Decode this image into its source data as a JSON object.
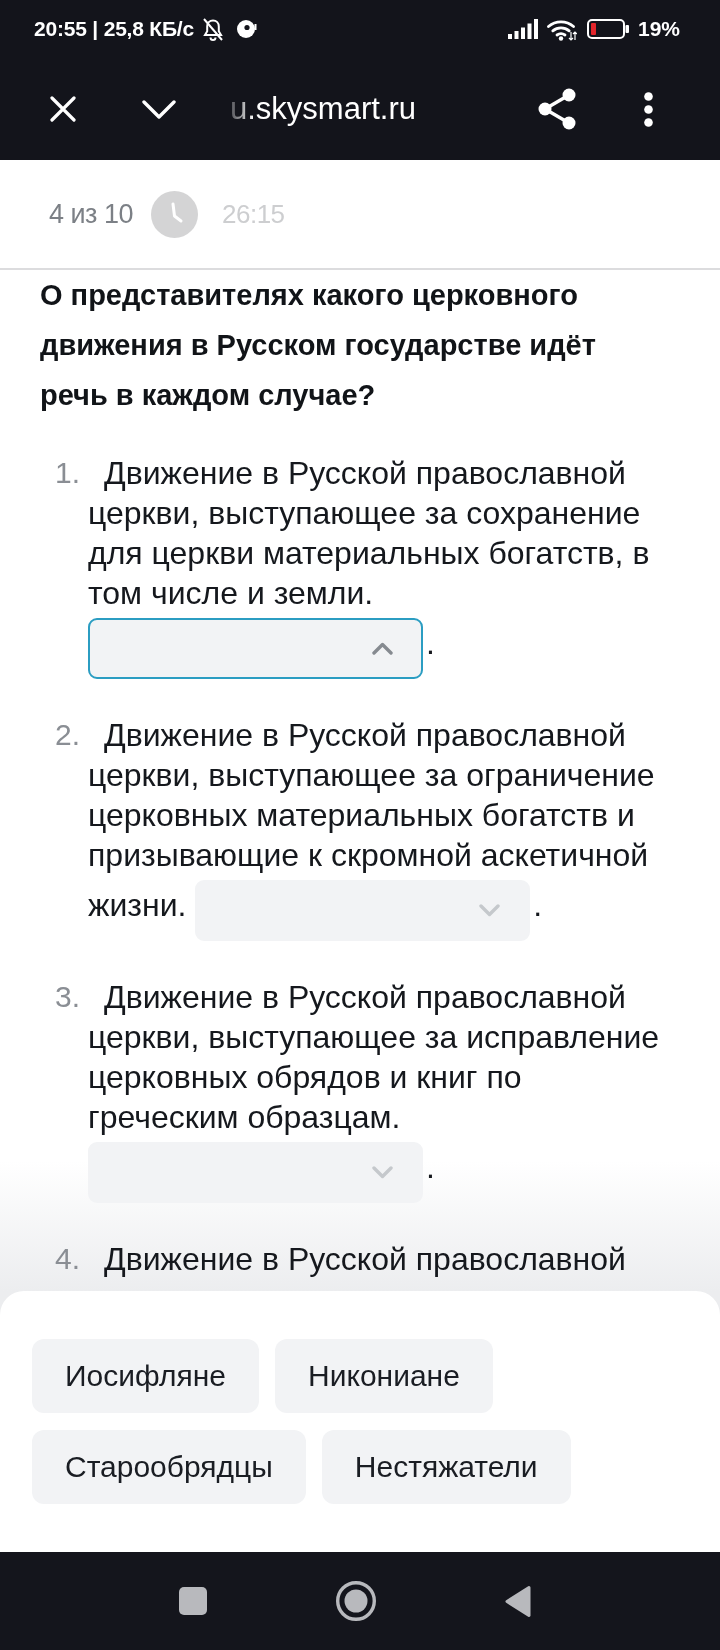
{
  "status_bar": {
    "time": "20:55 | 25,8 КБ/с",
    "battery": "19%"
  },
  "browser_bar": {
    "url": "u.skysmart.ru"
  },
  "quiz_header": {
    "counter": "4 из 10",
    "timer": "26:15"
  },
  "question": "О представителях какого церковного движения в Русском государстве идёт речь в каждом случае?",
  "items": [
    {
      "number": "1.",
      "text": "Движение в Русской православной церкви, выступающее за сохранение для церкви материальных богатств, в том числе и земли.",
      "dropdown": {
        "expanded": true
      },
      "suffix": "."
    },
    {
      "number": "2.",
      "text": "Движение в Русской православной церкви, выступающее за ограничение церковных материальных богатств и призывающие к скромной аскетичной жизни.",
      "dropdown": {
        "expanded": false
      },
      "suffix": "."
    },
    {
      "number": "3.",
      "text": "Движение в Русской православной церкви, выступающее за исправление церковных обрядов и книг по греческим образцам.",
      "dropdown": {
        "expanded": false
      },
      "suffix": "."
    },
    {
      "number": "4.",
      "text": "Движение в Русской православной"
    }
  ],
  "answer_options": [
    "Иосифляне",
    "Никониане",
    "Старообрядцы",
    "Нестяжатели"
  ]
}
